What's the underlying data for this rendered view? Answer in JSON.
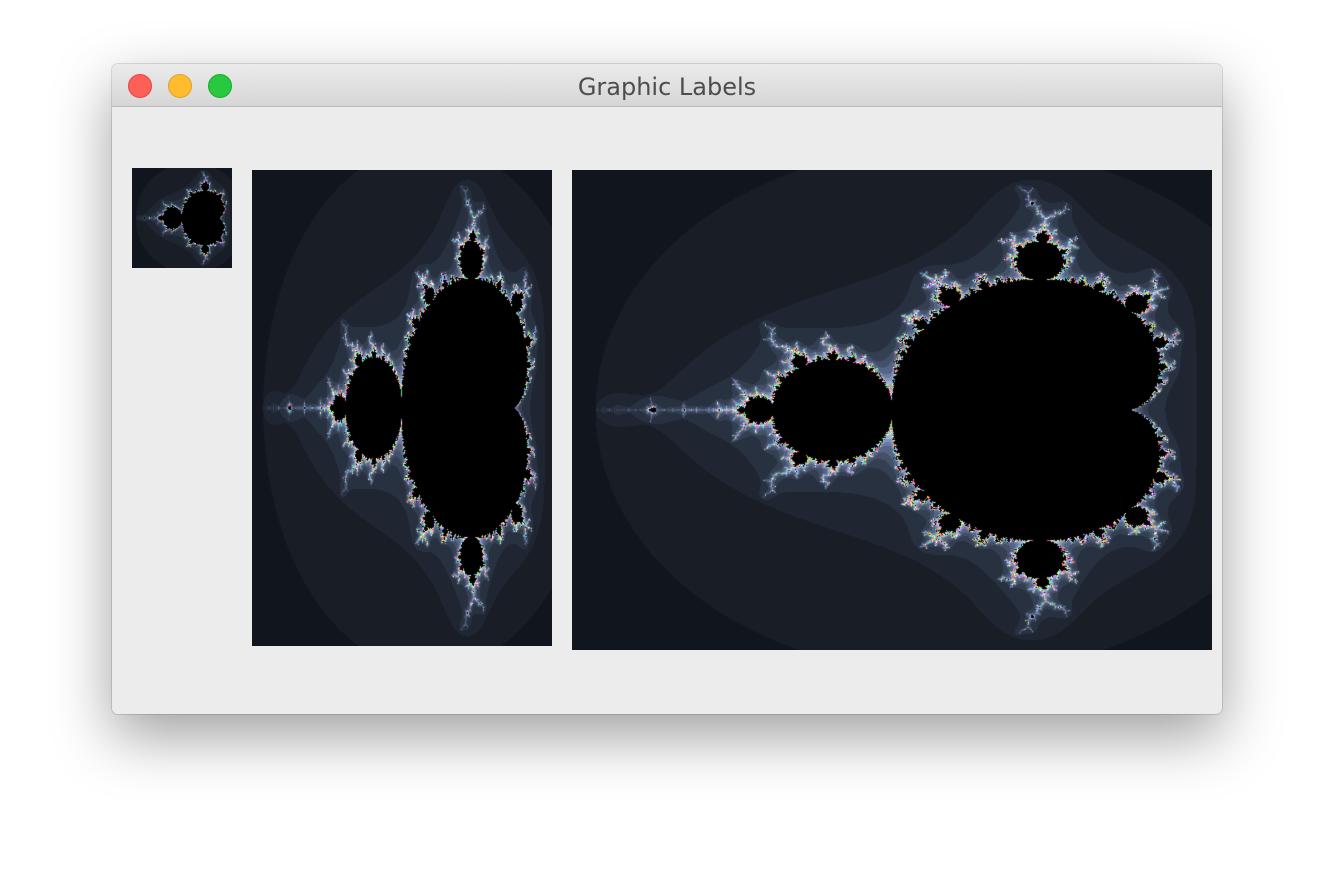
{
  "window": {
    "title": "Graphic Labels"
  },
  "controls": {
    "close": "close-button",
    "minimize": "minimize-button",
    "zoom": "zoom-button"
  },
  "colors": {
    "window_bg": "#ececec",
    "close": "#fe5f57",
    "minimize": "#febc2e",
    "zoom": "#28c840",
    "fractal_interior": "#000000",
    "fractal_far": "#111820"
  },
  "graphic_labels": [
    {
      "name": "small",
      "image": "mandelbrot-set"
    },
    {
      "name": "medium",
      "image": "mandelbrot-set"
    },
    {
      "name": "large",
      "image": "mandelbrot-set"
    }
  ]
}
